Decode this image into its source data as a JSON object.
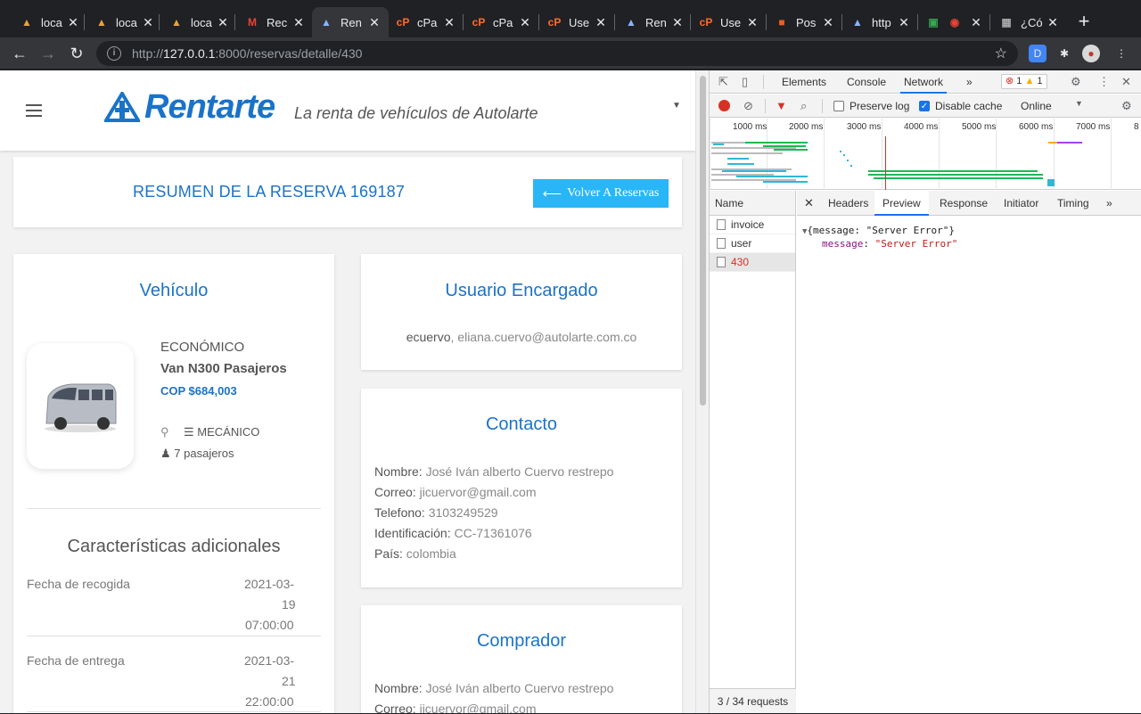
{
  "browser": {
    "tabs": [
      {
        "label": "loca",
        "icon": "ship-icon",
        "active": false
      },
      {
        "label": "loca",
        "icon": "ship-icon",
        "active": false
      },
      {
        "label": "loca",
        "icon": "ship-icon",
        "active": false
      },
      {
        "label": "Rec",
        "icon": "gmail-icon",
        "active": false
      },
      {
        "label": "Ren",
        "icon": "rentarte-icon",
        "active": true
      },
      {
        "label": "cPa",
        "icon": "cpanel-icon",
        "active": false
      },
      {
        "label": "cPa",
        "icon": "cpanel-icon",
        "active": false
      },
      {
        "label": "Use",
        "icon": "cpanel-icon",
        "active": false
      },
      {
        "label": "Ren",
        "icon": "rentarte-icon",
        "active": false
      },
      {
        "label": "Use",
        "icon": "cpanel-icon",
        "active": false
      },
      {
        "label": "Pos",
        "icon": "postman-icon",
        "active": false
      },
      {
        "label": "http",
        "icon": "rentarte-icon",
        "active": false
      },
      {
        "label": "",
        "icon": "record-icon",
        "active": false
      },
      {
        "label": "¿Có",
        "icon": "github-icon",
        "active": false
      }
    ],
    "url_host": "127.0.0.1",
    "url_prefix": "http://",
    "url_rest": ":8000/reservas/detalle/430"
  },
  "app": {
    "brand": "Rentarte",
    "tagline": "La renta de vehículos de Autolarte",
    "summary_title": "RESUMEN DE LA RESERVA 169187",
    "back_button": "Volver A Reservas",
    "colors": {
      "primary": "#1a73c8",
      "button": "#29b6f6"
    }
  },
  "vehicle": {
    "section_title": "Vehículo",
    "category": "ECONÓMICO",
    "name": "Van N300 Pasajeros",
    "price": "COP $684,003",
    "transmission": "MECÁNICO",
    "passengers": "7 pasajeros"
  },
  "additional": {
    "section_title": "Características adicionales",
    "rows": [
      {
        "label": "Fecha de recogida",
        "date": "2021-03-",
        "day": "19",
        "time": "07:00:00"
      },
      {
        "label": "Fecha de entrega",
        "date": "2021-03-",
        "day": "21",
        "time": "22:00:00"
      }
    ]
  },
  "user_in_charge": {
    "section_title": "Usuario Encargado",
    "username": "ecuervo",
    "email": ", eliana.cuervo@autolarte.com.co"
  },
  "contact": {
    "section_title": "Contacto",
    "fields": [
      {
        "label": "Nombre:",
        "value": " José Iván alberto Cuervo restrepo"
      },
      {
        "label": "Correo:",
        "value": " jicuervor@gmail.com"
      },
      {
        "label": "Telefono:",
        "value": " 3103249529"
      },
      {
        "label": "Identificación:",
        "value": " CC-71361076"
      },
      {
        "label": "País:",
        "value": " colombia"
      }
    ]
  },
  "buyer": {
    "section_title": "Comprador",
    "fields": [
      {
        "label": "Nombre:",
        "value": " José Iván alberto Cuervo restrepo"
      },
      {
        "label": "Correo:",
        "value": " jicuervor@gmail.com"
      }
    ]
  },
  "devtools": {
    "tabs": [
      "Elements",
      "Console",
      "Network"
    ],
    "active_tab": "Network",
    "more": "»",
    "errors": "1",
    "warnings": "1",
    "preserve_log": "Preserve log",
    "disable_cache": "Disable cache",
    "throttling": "Online",
    "timeline_ticks": [
      "1000 ms",
      "2000 ms",
      "3000 ms",
      "4000 ms",
      "5000 ms",
      "6000 ms",
      "7000 ms",
      "8"
    ],
    "name_header": "Name",
    "requests": [
      "invoice",
      "user",
      "430"
    ],
    "request_count": "3 / 34 requests",
    "detail_tabs": [
      "Headers",
      "Preview",
      "Response",
      "Initiator",
      "Timing"
    ],
    "detail_active": "Preview",
    "preview_line1": "{message: \"Server Error\"}",
    "preview_key": "message",
    "preview_value": "\"Server Error\""
  }
}
